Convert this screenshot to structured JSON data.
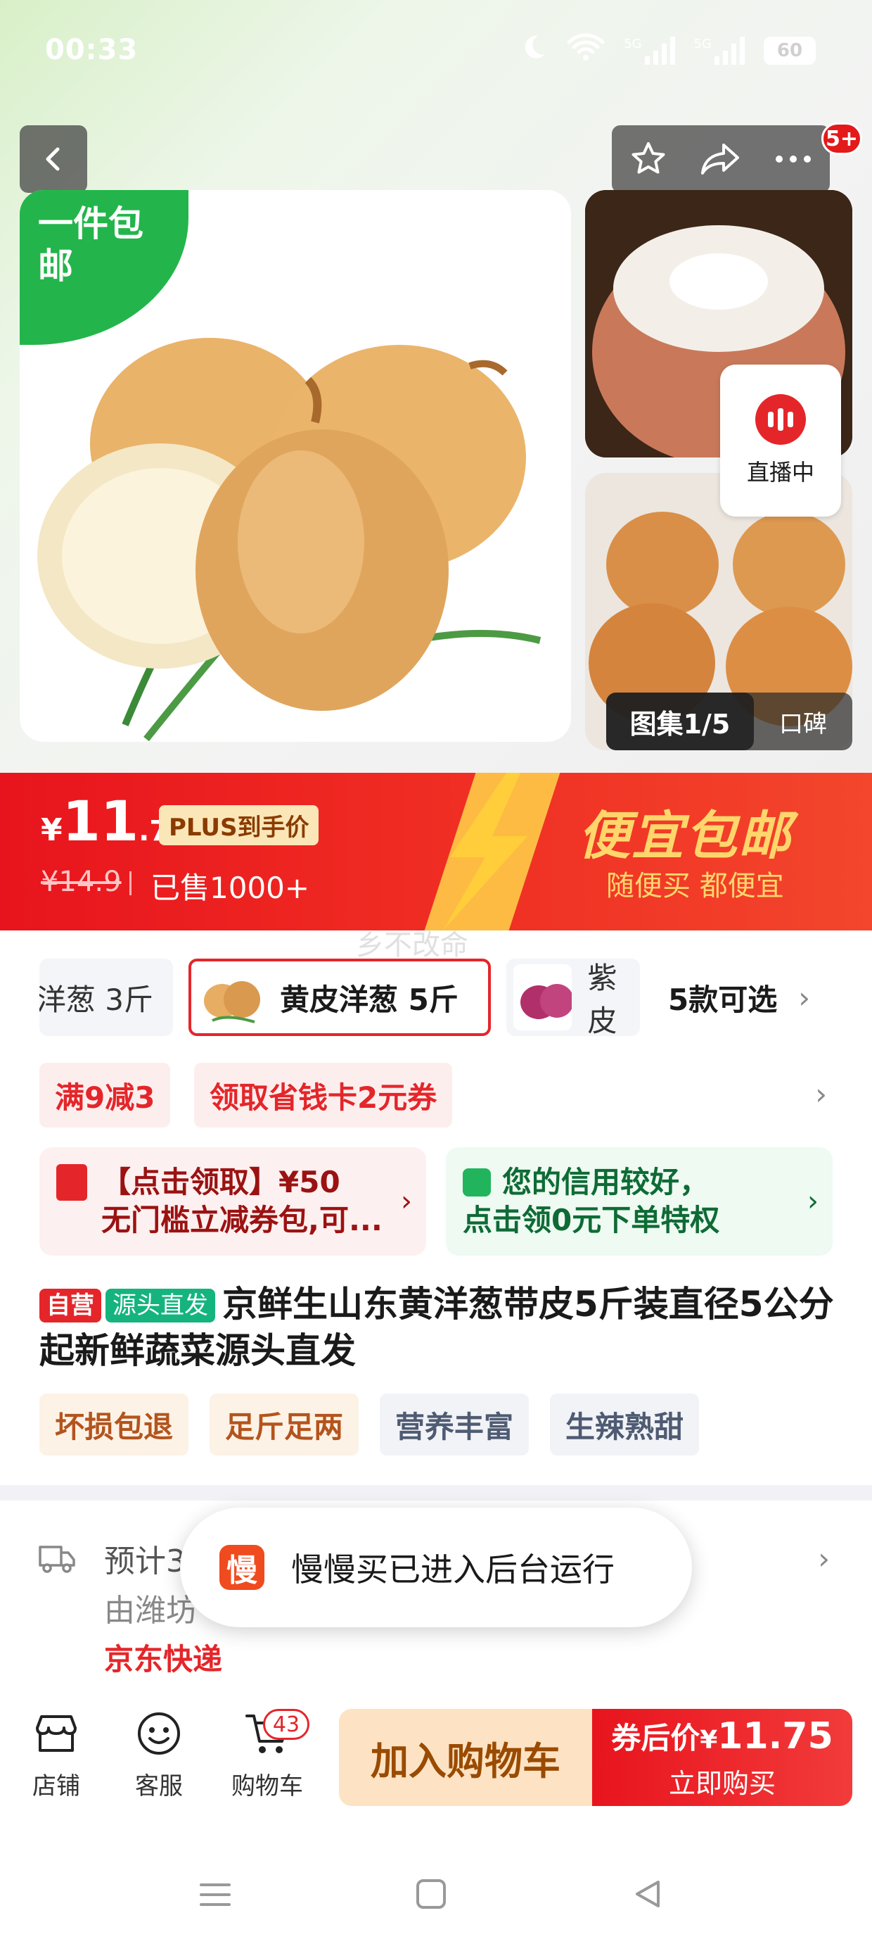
{
  "status_bar": {
    "time": "00:33",
    "signal1": "5G",
    "signal2": "5G",
    "battery": "60"
  },
  "header": {
    "back_icon": "chevron-left-icon",
    "actions": [
      "star-icon",
      "share-icon",
      "more-icon"
    ],
    "badge": "5+"
  },
  "gallery": {
    "ribbon_text": "一件包邮",
    "live_label": "直播中",
    "counter": "图集1/5",
    "reviews": "口碑"
  },
  "price": {
    "currency": "¥",
    "integer": "11",
    "decimal": ".75",
    "plus_label": "PLUS到手价",
    "original": "¥14.9",
    "sold": "已售1000+",
    "promo_title": "便宜包邮",
    "promo_subtitle": "随便买 都便宜"
  },
  "watermark": "乡不改命",
  "sku": {
    "items": [
      {
        "label": "洋葱 3斤"
      },
      {
        "label": "黄皮洋葱 5斤",
        "selected": true
      },
      {
        "label": "紫皮"
      }
    ],
    "more_label": "5款可选"
  },
  "coupons": [
    "满9减3",
    "领取省钱卡2元券"
  ],
  "cards": {
    "voucher": {
      "line1": "【点击领取】¥50",
      "line2": "无门槛立减券包,可..."
    },
    "credit": {
      "line1": "您的信用较好，",
      "line2": "点击领0元下单特权"
    }
  },
  "product": {
    "tag_self": "自营",
    "tag_source": "源头直发",
    "title": "京鲜生山东黄洋葱带皮5斤装直径5公分起新鲜蔬菜源头直发"
  },
  "features": [
    "坏损包退",
    "足斤足两",
    "营养丰富",
    "生辣熟甜"
  ],
  "delivery": {
    "line1": "预计3",
    "line2": "由潍坊",
    "courier": "京东快递"
  },
  "toast": {
    "icon_char": "慢",
    "text": "慢慢买已进入后台运行"
  },
  "bottom_bar": {
    "shop": "店铺",
    "service": "客服",
    "cart": "购物车",
    "cart_count": "43",
    "add_to_cart": "加入购物车",
    "buy_prefix": "券后价",
    "buy_currency": "¥",
    "buy_price": "11.75",
    "buy_now": "立即购买"
  },
  "colors": {
    "accent_red": "#e4262a",
    "promo_yellow": "#ffd66b",
    "green": "#23b54b"
  }
}
